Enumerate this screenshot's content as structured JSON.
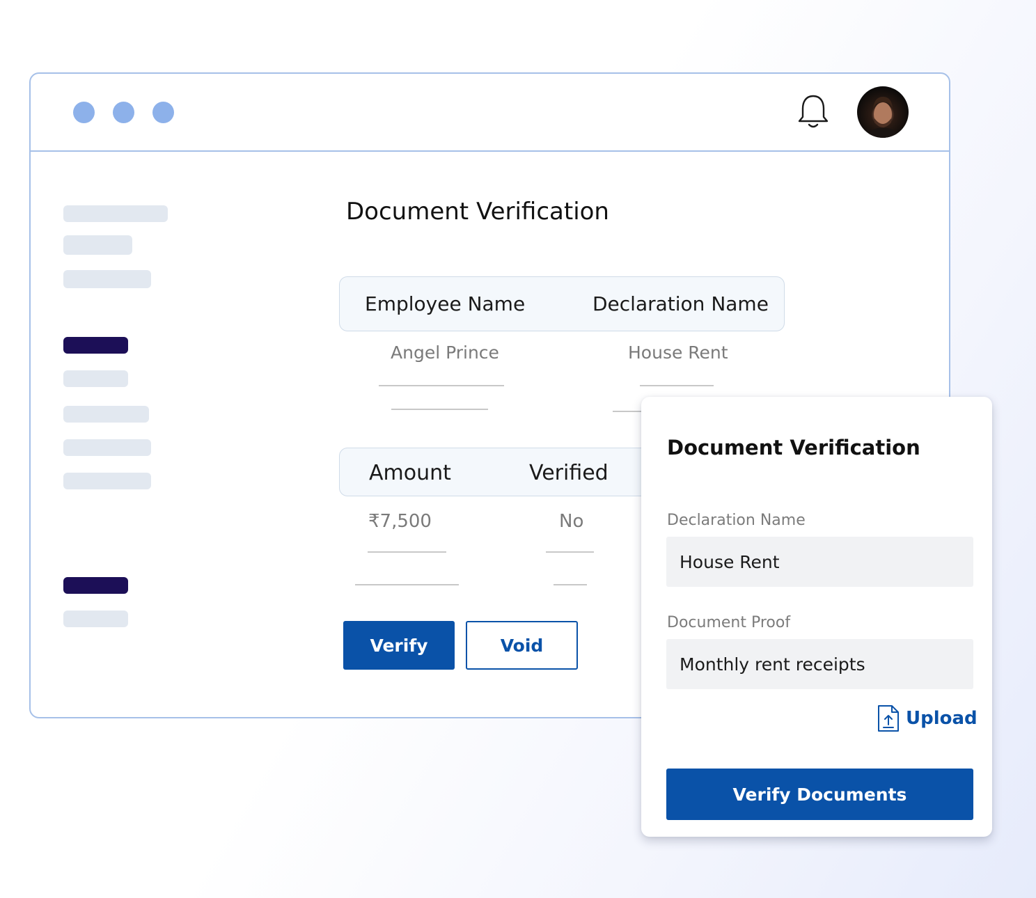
{
  "main": {
    "title": "Document Verification",
    "table1": {
      "headers": [
        "Employee Name",
        "Declaration Name"
      ],
      "values": [
        "Angel Prince",
        "House Rent"
      ]
    },
    "table2": {
      "headers": [
        "Amount",
        "Verified"
      ],
      "values": [
        "₹7,500",
        "No"
      ]
    },
    "buttons": {
      "verify": "Verify",
      "void": "Void"
    }
  },
  "panel": {
    "title": "Document Verification",
    "declaration_label": "Declaration Name",
    "declaration_value": "House Rent",
    "proof_label": "Document Proof",
    "proof_value": "Monthly rent receipts",
    "upload_label": "Upload",
    "submit_label": "Verify Documents"
  },
  "icons": {
    "window_dots": "window-control-dots",
    "notifications": "bell-icon",
    "upload": "file-upload-icon"
  },
  "colors": {
    "primary": "#0a52a8",
    "window_border": "#a6c0e8",
    "dot": "#8db1ea",
    "sidebar_active": "#1c0f57",
    "sidebar_placeholder": "#e2e8f0"
  }
}
